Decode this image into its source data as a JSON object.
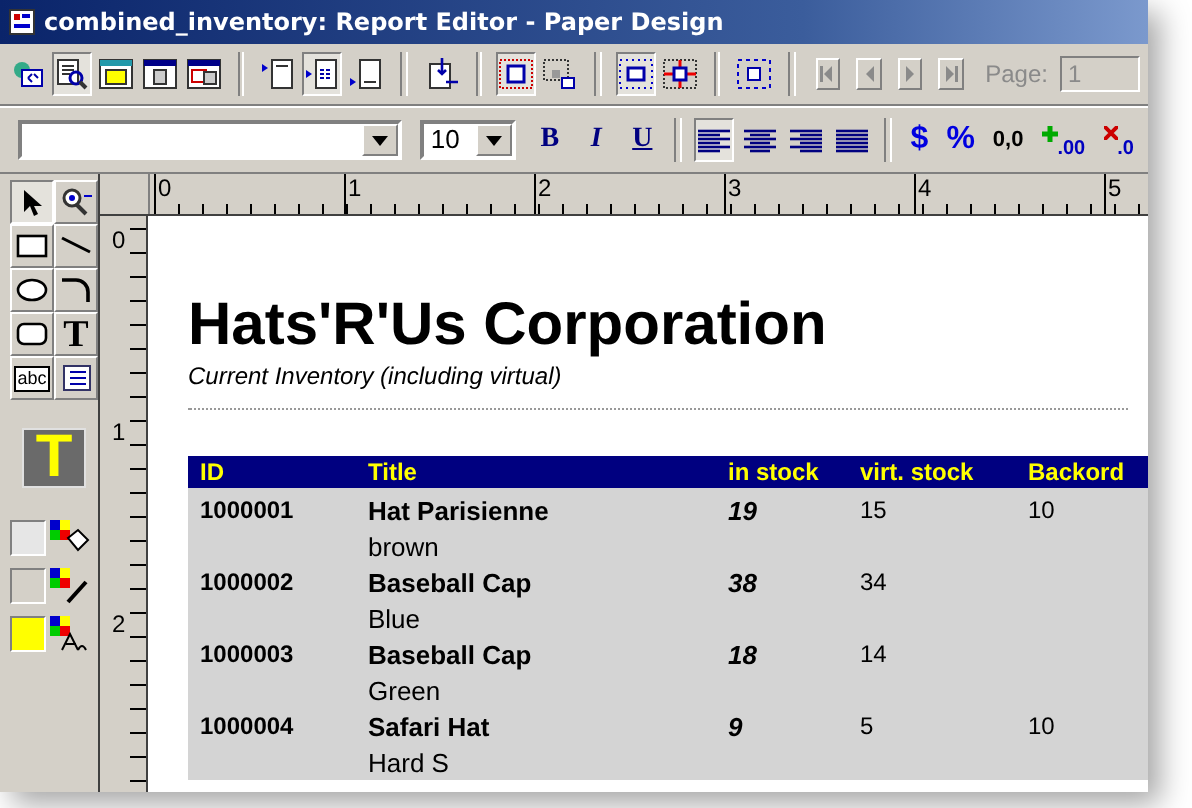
{
  "window": {
    "title": "combined_inventory: Report Editor - Paper Design"
  },
  "toolbar": [
    {
      "kind": "connect",
      "pressed": false
    },
    {
      "kind": "preview",
      "pressed": true
    },
    {
      "kind": "folder",
      "pressed": false
    },
    {
      "kind": "database",
      "pressed": false
    },
    {
      "kind": "windows",
      "pressed": false
    },
    {
      "kind": "sep"
    },
    {
      "kind": "header",
      "pressed": false
    },
    {
      "kind": "detail",
      "pressed": true
    },
    {
      "kind": "footer",
      "pressed": false
    },
    {
      "kind": "sep"
    },
    {
      "kind": "insert",
      "pressed": false
    },
    {
      "kind": "sep"
    },
    {
      "kind": "frame",
      "pressed": true
    },
    {
      "kind": "shadow",
      "pressed": false
    },
    {
      "kind": "sep"
    },
    {
      "kind": "center",
      "pressed": true
    },
    {
      "kind": "cross",
      "pressed": false
    },
    {
      "kind": "sep"
    },
    {
      "kind": "select",
      "pressed": false
    },
    {
      "kind": "sep"
    }
  ],
  "page_navigation": {
    "label": "Page:",
    "value": "1",
    "disabled": true
  },
  "format_bar": {
    "font_size": "10",
    "styles": [
      {
        "kind": "bold",
        "label": "B"
      },
      {
        "kind": "italic",
        "label": "I"
      },
      {
        "kind": "underline",
        "label": "U"
      }
    ],
    "alignment": [
      {
        "kind": "left",
        "selected": true
      },
      {
        "kind": "center",
        "selected": false
      },
      {
        "kind": "right",
        "selected": false
      },
      {
        "kind": "justify",
        "selected": false
      }
    ],
    "number_formats": [
      {
        "kind": "currency",
        "label": "$"
      },
      {
        "kind": "percent",
        "label": "%"
      },
      {
        "kind": "thousands",
        "label": "0,0"
      },
      {
        "kind": "add_decimal",
        "label": ".00"
      },
      {
        "kind": "remove_decimal",
        "label": ".0"
      }
    ]
  },
  "tools": [
    {
      "kind": "pointer",
      "selected": true
    },
    {
      "kind": "zoom",
      "selected": false
    },
    {
      "kind": "rectangle",
      "selected": false
    },
    {
      "kind": "line",
      "selected": false
    },
    {
      "kind": "ellipse",
      "selected": false
    },
    {
      "kind": "arc",
      "selected": false
    },
    {
      "kind": "rounded",
      "selected": false
    },
    {
      "kind": "text",
      "selected": false,
      "glyph": "T"
    },
    {
      "kind": "field",
      "selected": false,
      "glyph": "abc"
    },
    {
      "kind": "memo",
      "selected": false
    }
  ],
  "text_preview": {
    "glyph": "T",
    "color": "#ffff00"
  },
  "swatches": [
    {
      "kind": "fill",
      "color": "#e6e6e6"
    },
    {
      "kind": "line",
      "color": "#d4d0c8"
    },
    {
      "kind": "text",
      "color": "#ffff00"
    }
  ],
  "rulers": {
    "horizontal": [
      "0",
      "1",
      "2",
      "3",
      "4",
      "5"
    ],
    "vertical": [
      "0",
      "1",
      "2"
    ]
  },
  "report": {
    "title": "Hats'R'Us Corporation",
    "subtitle": "Current Inventory (including virtual)",
    "columns": [
      "ID",
      "Title",
      "in stock",
      "virt. stock",
      "Backord"
    ],
    "rows": [
      {
        "id": "1000001",
        "title": "Hat Parisienne",
        "variant": "brown",
        "in_stock": "19",
        "virt_stock": "15",
        "backorder": "10"
      },
      {
        "id": "1000002",
        "title": "Baseball Cap",
        "variant": "Blue",
        "in_stock": "38",
        "virt_stock": "34"
      },
      {
        "id": "1000003",
        "title": "Baseball Cap",
        "variant": "Green",
        "in_stock": "18",
        "virt_stock": "14"
      },
      {
        "id": "1000004",
        "title": "Safari Hat",
        "variant": "Hard S",
        "in_stock": "9",
        "virt_stock": "5",
        "backorder": "10"
      }
    ]
  }
}
